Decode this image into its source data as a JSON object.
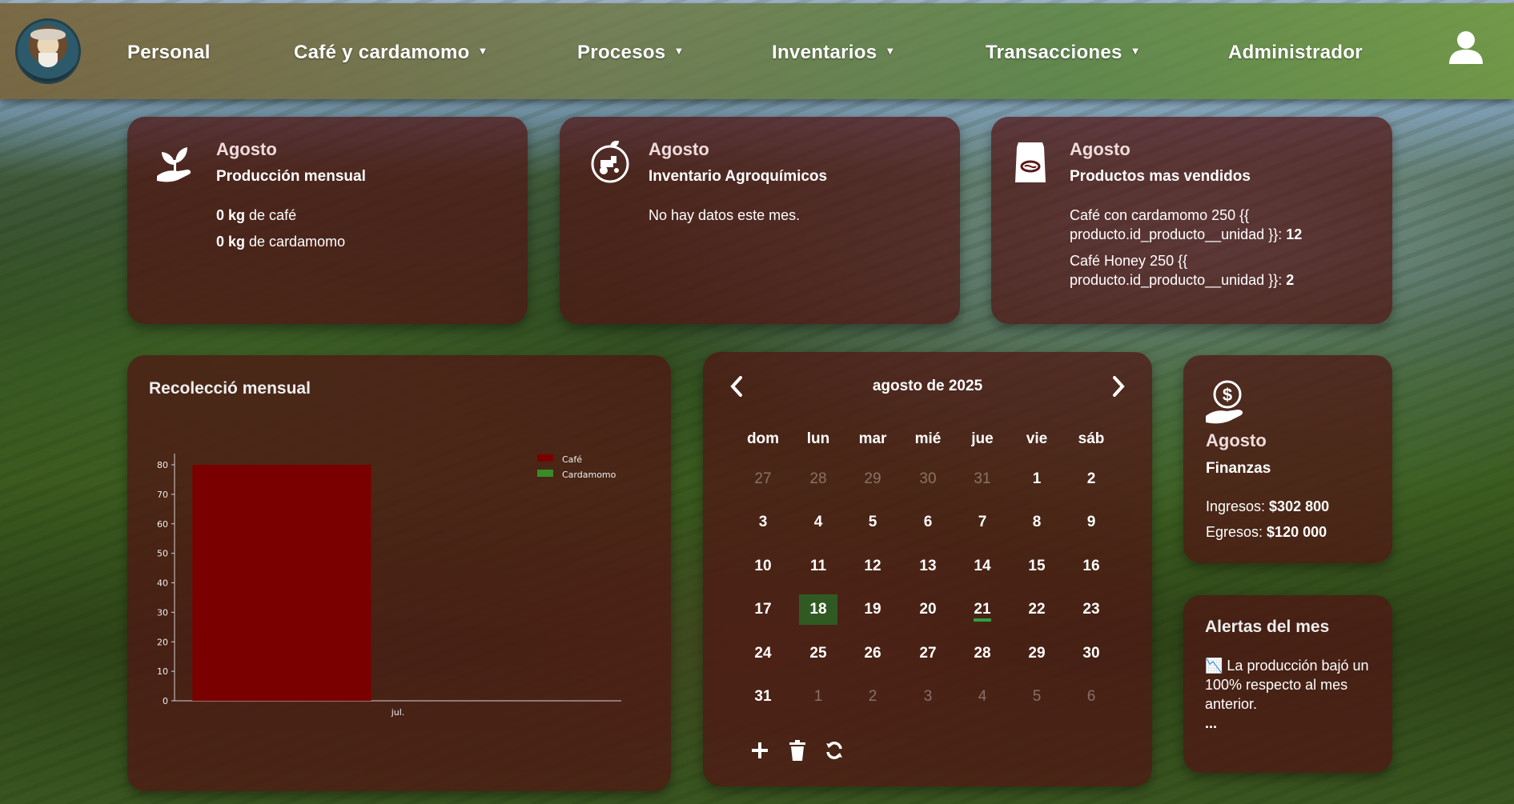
{
  "nav": {
    "items": [
      {
        "label": "Personal",
        "dropdown": false
      },
      {
        "label": "Café y cardamomo",
        "dropdown": true
      },
      {
        "label": "Procesos",
        "dropdown": true
      },
      {
        "label": "Inventarios",
        "dropdown": true
      },
      {
        "label": "Transacciones",
        "dropdown": true
      },
      {
        "label": "Administrador",
        "dropdown": false
      }
    ]
  },
  "cards": {
    "production": {
      "month": "Agosto",
      "title": "Producción mensual",
      "coffee_value": "0 kg",
      "coffee_suffix": " de café",
      "cardamom_value": "0 kg",
      "cardamom_suffix": " de cardamomo"
    },
    "agrochem": {
      "month": "Agosto",
      "title": "Inventario Agroquímicos",
      "message": "No hay datos este mes."
    },
    "top_products": {
      "month": "Agosto",
      "title": "Productos mas vendidos",
      "items": [
        {
          "text": "Café con cardamomo 250 {{ producto.id_producto__unidad }}: ",
          "count": "12"
        },
        {
          "text": "Café Honey 250 {{ producto.id_producto__unidad }}: ",
          "count": "2"
        }
      ]
    },
    "finance": {
      "month": "Agosto",
      "title": "Finanzas",
      "income_label": "Ingresos: ",
      "income_value": "$302 800",
      "expense_label": "Egresos: ",
      "expense_value": "$120 000"
    },
    "alerts": {
      "title": "Alertas del mes",
      "icon": "📉",
      "message": " La producción bajó un 100% respecto al mes anterior.",
      "more": "..."
    }
  },
  "chart_data": {
    "type": "bar",
    "title": "Recolecció mensual",
    "categories": [
      "jul."
    ],
    "series": [
      {
        "name": "Café",
        "values": [
          80
        ],
        "color": "#7a0000"
      },
      {
        "name": "Cardamomo",
        "values": [
          0
        ],
        "color": "#3a8a2a"
      }
    ],
    "ylim": [
      0,
      80
    ],
    "yticks": [
      0,
      10,
      20,
      30,
      40,
      50,
      60,
      70,
      80
    ],
    "legend": "top-right"
  },
  "calendar": {
    "title": "agosto de 2025",
    "weekdays": [
      "dom",
      "lun",
      "mar",
      "mié",
      "jue",
      "vie",
      "sáb"
    ],
    "weeks": [
      [
        [
          "27",
          1
        ],
        [
          "28",
          1
        ],
        [
          "29",
          1
        ],
        [
          "30",
          1
        ],
        [
          "31",
          1
        ],
        [
          "1",
          0
        ],
        [
          "2",
          0
        ]
      ],
      [
        [
          "3",
          0
        ],
        [
          "4",
          0
        ],
        [
          "5",
          0
        ],
        [
          "6",
          0
        ],
        [
          "7",
          0
        ],
        [
          "8",
          0
        ],
        [
          "9",
          0
        ]
      ],
      [
        [
          "10",
          0
        ],
        [
          "11",
          0
        ],
        [
          "12",
          0
        ],
        [
          "13",
          0
        ],
        [
          "14",
          0
        ],
        [
          "15",
          0
        ],
        [
          "16",
          0
        ]
      ],
      [
        [
          "17",
          0
        ],
        [
          "18",
          0
        ],
        [
          "19",
          0
        ],
        [
          "20",
          0
        ],
        [
          "21",
          0
        ],
        [
          "22",
          0
        ],
        [
          "23",
          0
        ]
      ],
      [
        [
          "24",
          0
        ],
        [
          "25",
          0
        ],
        [
          "26",
          0
        ],
        [
          "27",
          0
        ],
        [
          "28",
          0
        ],
        [
          "29",
          0
        ],
        [
          "30",
          0
        ]
      ],
      [
        [
          "31",
          0
        ],
        [
          "1",
          1
        ],
        [
          "2",
          1
        ],
        [
          "3",
          1
        ],
        [
          "4",
          1
        ],
        [
          "5",
          1
        ],
        [
          "6",
          1
        ]
      ]
    ],
    "today": "18",
    "marked": "21"
  },
  "colors": {
    "card_bg": "rgba(80,20,20,0.72)",
    "today_bg": "#2b6e2b",
    "mark": "#2ea043"
  }
}
